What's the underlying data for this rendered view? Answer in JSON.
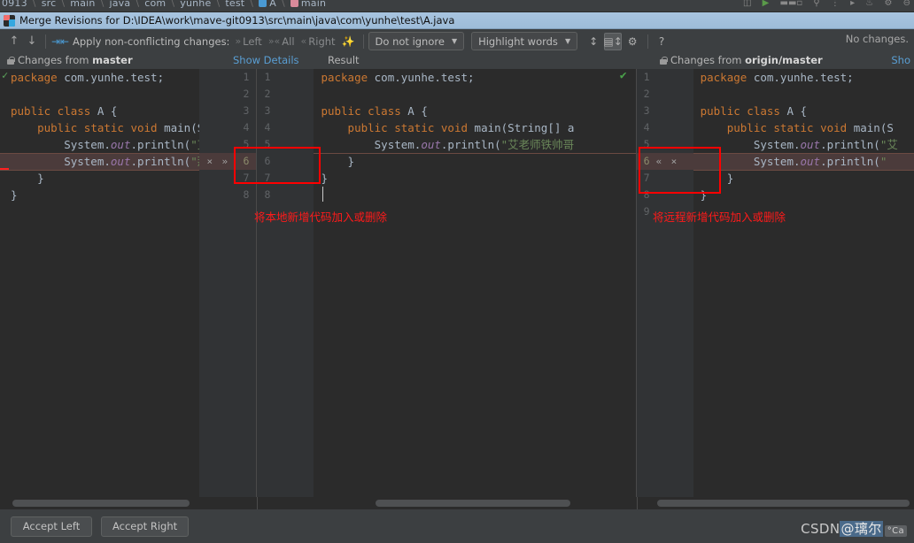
{
  "ide_strip": {
    "breadcrumbs": [
      "0913",
      "src",
      "main",
      "java",
      "com",
      "yunhe",
      "test",
      "A",
      "main"
    ]
  },
  "titlebar": {
    "title": "Merge Revisions for D:\\IDEA\\work\\mave-git0913\\src\\main\\java\\com\\yunhe\\test\\A.java",
    "icon": "intellij-idea-icon"
  },
  "toolbar": {
    "prev_icon": "arrow-up-icon",
    "next_icon": "arrow-down-icon",
    "merge_icon": "apply-changes-icon",
    "apply_label": "Apply non-conflicting changes:",
    "apply_left": "Left",
    "apply_all": "All",
    "apply_right": "Right",
    "magic_icon": "magic-wand-icon",
    "ignore_combo": "Do not ignore",
    "highlight_combo": "Highlight words",
    "collapse_icon": "collapse-unchanged-icon",
    "diff_mode_icon": "side-by-side-viewer-icon",
    "settings_icon": "gear-icon",
    "help_icon": "help-icon",
    "status": "No changes. "
  },
  "headers": {
    "left_prefix": "Changes from ",
    "left_branch": "master",
    "show_details": "Show Details",
    "result": "Result",
    "right_prefix": "Changes from ",
    "right_branch": "origin/master",
    "right_show": "Sho"
  },
  "left_pane": {
    "name": "local-changes-pane",
    "line_numbers": [
      "1",
      "2",
      "3",
      "4",
      "5",
      "6",
      "7",
      "8"
    ],
    "lines": [
      "package com.yunhe.test;",
      "",
      "public class A {",
      "    public static void main(String",
      "        System.out.println(\"艾老师铁",
      "        System.out.println(\"那是当然",
      "    }",
      "}"
    ],
    "conflict_line": "6",
    "gutter_actions": [
      "×",
      "»"
    ],
    "gutter_action_names": [
      "revert-change-icon",
      "accept-right-icon"
    ],
    "valid_icon": "checkmark-green-icon"
  },
  "middle_pane": {
    "name": "merge-result-pane",
    "line_numbers": [
      "1",
      "2",
      "3",
      "4",
      "5",
      "6",
      "7",
      "8"
    ],
    "lines": [
      "package com.yunhe.test;",
      "",
      "public class A {",
      "    public static void main(String[] a",
      "        System.out.println(\"艾老师铁帅哥",
      "    }",
      "}",
      ""
    ],
    "ok_icon": "checkmark-icon"
  },
  "right_pane": {
    "name": "remote-changes-pane",
    "line_numbers": [
      "1",
      "2",
      "3",
      "4",
      "5",
      "6",
      "7",
      "8",
      "9"
    ],
    "lines": [
      "package com.yunhe.test;",
      "",
      "public class A {",
      "    public static void main(S",
      "        System.out.println(\"艾",
      "        System.out.println(\"",
      "    }",
      "}",
      ""
    ],
    "conflict_line": "6",
    "gutter_actions": [
      "«",
      "×"
    ],
    "gutter_action_names": [
      "accept-left-icon",
      "revert-change-icon"
    ]
  },
  "annotations": {
    "left_note": "将本地新增代码加入或删除",
    "right_note": "将远程新增代码加入或删除",
    "box_color": "#ff0000"
  },
  "bottombar": {
    "accept_left": "Accept Left",
    "accept_right": "Accept Right"
  },
  "watermark": {
    "brand": "CSDN",
    "handle": "@璃尔",
    "tag": "°Ca"
  },
  "colors": {
    "background": "#3c3f41",
    "editor_bg": "#2b2b2b",
    "gutter_bg": "#313335",
    "keyword": "#cc7832",
    "string": "#6a8759",
    "field": "#9876aa",
    "text": "#a9b7c6",
    "link": "#5a9fd4",
    "conflict_band": "#4b3b3b",
    "annotation": "#ff0000",
    "title_bar": "#a8c4df"
  }
}
